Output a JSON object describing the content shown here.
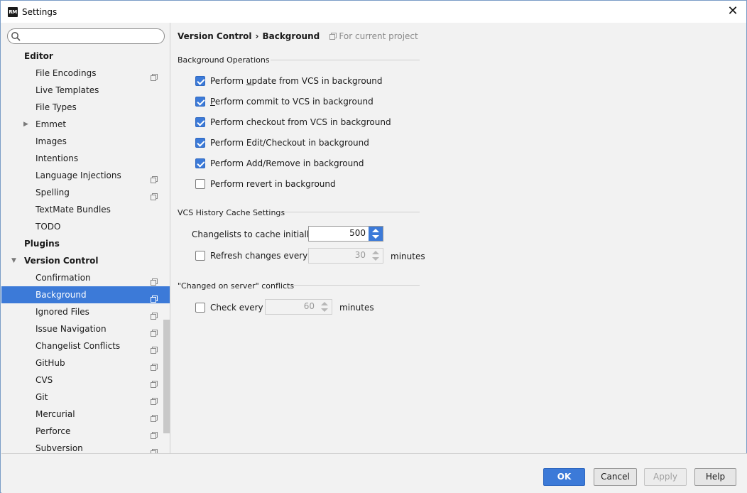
{
  "window": {
    "title": "Settings",
    "app_icon_text": "RM"
  },
  "search": {
    "placeholder": ""
  },
  "sidebar": {
    "items": [
      {
        "label": "Editor",
        "type": "section",
        "icon": false
      },
      {
        "label": "File Encodings",
        "type": "child",
        "icon": true
      },
      {
        "label": "Live Templates",
        "type": "child",
        "icon": false
      },
      {
        "label": "File Types",
        "type": "child",
        "icon": false
      },
      {
        "label": "Emmet",
        "type": "child-collapsed",
        "icon": false
      },
      {
        "label": "Images",
        "type": "child",
        "icon": false
      },
      {
        "label": "Intentions",
        "type": "child",
        "icon": false
      },
      {
        "label": "Language Injections",
        "type": "child",
        "icon": true
      },
      {
        "label": "Spelling",
        "type": "child",
        "icon": true
      },
      {
        "label": "TextMate Bundles",
        "type": "child",
        "icon": false
      },
      {
        "label": "TODO",
        "type": "child",
        "icon": false
      },
      {
        "label": "Plugins",
        "type": "section",
        "icon": false
      },
      {
        "label": "Version Control",
        "type": "section-expanded",
        "icon": false
      },
      {
        "label": "Confirmation",
        "type": "child",
        "icon": true
      },
      {
        "label": "Background",
        "type": "child",
        "icon": true,
        "selected": true
      },
      {
        "label": "Ignored Files",
        "type": "child",
        "icon": true
      },
      {
        "label": "Issue Navigation",
        "type": "child",
        "icon": true
      },
      {
        "label": "Changelist Conflicts",
        "type": "child",
        "icon": true
      },
      {
        "label": "GitHub",
        "type": "child",
        "icon": true
      },
      {
        "label": "CVS",
        "type": "child",
        "icon": true
      },
      {
        "label": "Git",
        "type": "child",
        "icon": true
      },
      {
        "label": "Mercurial",
        "type": "child",
        "icon": true
      },
      {
        "label": "Perforce",
        "type": "child",
        "icon": true
      },
      {
        "label": "Subversion",
        "type": "child",
        "icon": true
      }
    ]
  },
  "breadcrumb": {
    "parent": "Version Control",
    "separator": "›",
    "current": "Background",
    "scope": "For current project"
  },
  "background_operations": {
    "title": "Background Operations",
    "options": [
      {
        "pre": "Perform ",
        "u": "u",
        "post": "pdate from VCS in background",
        "checked": true
      },
      {
        "pre": "",
        "u": "P",
        "post": "erform commit to VCS in background",
        "checked": true
      },
      {
        "pre": "Perform checkout from VCS in background",
        "u": "",
        "post": "",
        "checked": true
      },
      {
        "pre": "Perform Edit/Checkout in background",
        "u": "",
        "post": "",
        "checked": true
      },
      {
        "pre": "Perform Add/Remove in background",
        "u": "",
        "post": "",
        "checked": true
      },
      {
        "pre": "Perform revert in background",
        "u": "",
        "post": "",
        "checked": false
      }
    ]
  },
  "cache_settings": {
    "title": "VCS History Cache Settings",
    "changelists_label": "Changelists to cache initially:",
    "changelists_value": "500",
    "refresh_label": "Refresh changes every",
    "refresh_checked": false,
    "refresh_value": "30",
    "refresh_unit": "minutes"
  },
  "conflicts": {
    "title": "\"Changed on server\" conflicts",
    "check_label": "Check every",
    "check_checked": false,
    "check_value": "60",
    "check_unit": "minutes"
  },
  "footer": {
    "ok": "OK",
    "cancel": "Cancel",
    "apply": "Apply",
    "help": "Help"
  },
  "colors": {
    "accent": "#3c7ad8",
    "background": "#f2f2f2"
  }
}
